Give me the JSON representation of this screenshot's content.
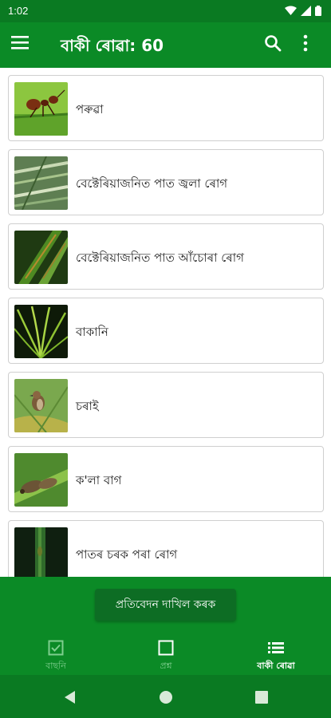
{
  "status_bar": {
    "time": "1:02"
  },
  "app_bar": {
    "title": "বাকী ৰোৱা: 60"
  },
  "list": {
    "items": [
      {
        "label": "পৰুৱা"
      },
      {
        "label": "বেক্টেৰিয়াজনিত পাত জ্বলা ৰোগ"
      },
      {
        "label": "বেক্টেৰিয়াজনিত পাত আঁচোৰা ৰোগ"
      },
      {
        "label": "বাকানি"
      },
      {
        "label": "চৰাই"
      },
      {
        "label": "ক'লা বাগ"
      },
      {
        "label": "পাতৰ চৰক পৰা ৰোগ"
      }
    ]
  },
  "bottom": {
    "submit_label": "প্ৰতিবেদন দাখিল কৰক",
    "nav": [
      {
        "label": "বাছনি",
        "icon": "checkbox-icon"
      },
      {
        "label": "প্ৰশ্ন",
        "icon": "square-icon"
      },
      {
        "label": "বাকী ৰোৱা",
        "icon": "list-icon",
        "active": true
      }
    ]
  },
  "colors": {
    "primary": "#0b8a26",
    "status_bar": "#0a7a22",
    "button": "#0d6d24",
    "inactive_nav": "#7fcf8f"
  }
}
